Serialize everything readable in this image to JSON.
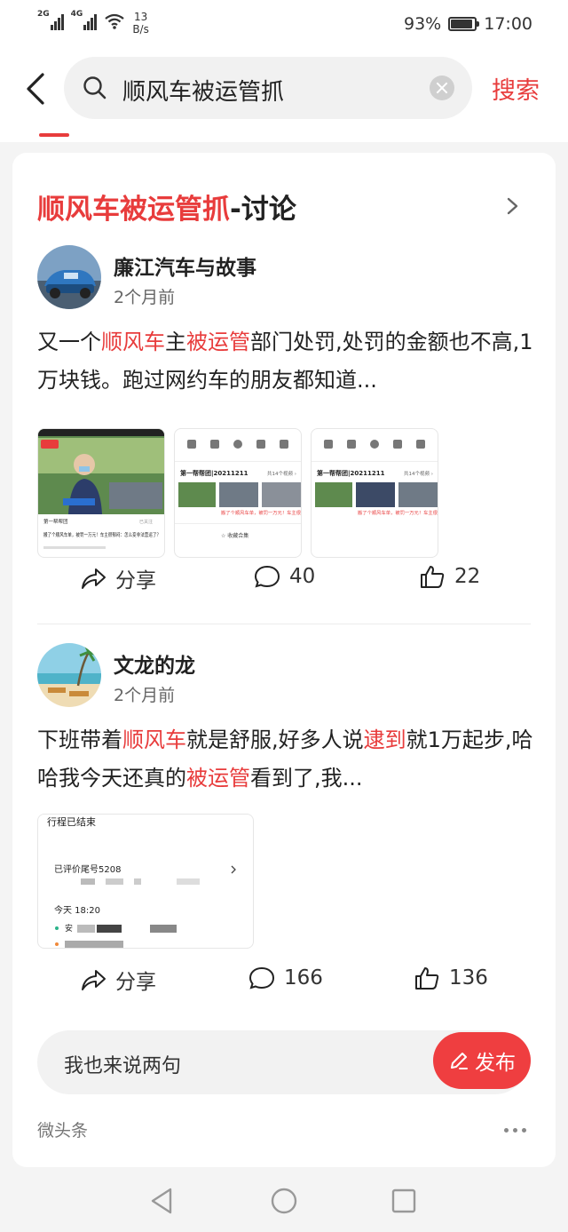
{
  "status_bar": {
    "signal_1": "2G",
    "signal_2": "4G",
    "speed_value": "13",
    "speed_unit": "B/s",
    "battery": "93%",
    "battery_level": 0.93,
    "time": "17:00"
  },
  "search": {
    "query": "顺风车被运管抓",
    "submit_label": "搜索"
  },
  "card": {
    "title_keyword": "顺风车被运管抓",
    "title_suffix": "-讨论",
    "input_placeholder": "我也来说两句",
    "publish_label": "发布",
    "source": "微头条"
  },
  "posts": [
    {
      "author": "廉江汽车与故事",
      "time": "2个月前",
      "text_parts": [
        "又一个",
        "顺风车",
        "主",
        "被运管",
        "部门处罚,处罚的金额也不高,1万块钱。跑过网约车的朋友都知道..."
      ],
      "share_label": "分享",
      "comments": "40",
      "likes": "22"
    },
    {
      "author": "文龙的龙",
      "time": "2个月前",
      "text_parts": [
        "下班带着",
        "顺风车",
        "就是舒服,好多人说",
        "逮到",
        "就1万起步,哈哈我今天还真的",
        "被运管",
        "看到了,我..."
      ],
      "share_label": "分享",
      "comments": "166",
      "likes": "136"
    }
  ],
  "thumbs": {
    "t1_channel": "第一帮帮团",
    "t1_caption": "搬了个顺风车单，被罚一万元！车主很郁闷：怎么变非法营运了？",
    "t1_follow": "已关注",
    "t2_title": "第一帮帮团|20211211",
    "t2_more": "共14个视频 ›",
    "t2_caption": "搬了个顺风车单，被罚一万元！车主很",
    "t2_collect": "☆ 收藏合集",
    "t3_title": "第一帮帮团|20211211",
    "t3_more": "共14个视频 ›",
    "t3_caption": "搬了个顺风车单，被罚一万元！车主很",
    "t4_status": "行程已结束",
    "t4_rating": "已评价尾号5208",
    "t4_date": "今天 18:20",
    "t4_from": "安"
  },
  "colors": {
    "accent": "#e83c3c",
    "publish_bg": "#ef3e40"
  }
}
